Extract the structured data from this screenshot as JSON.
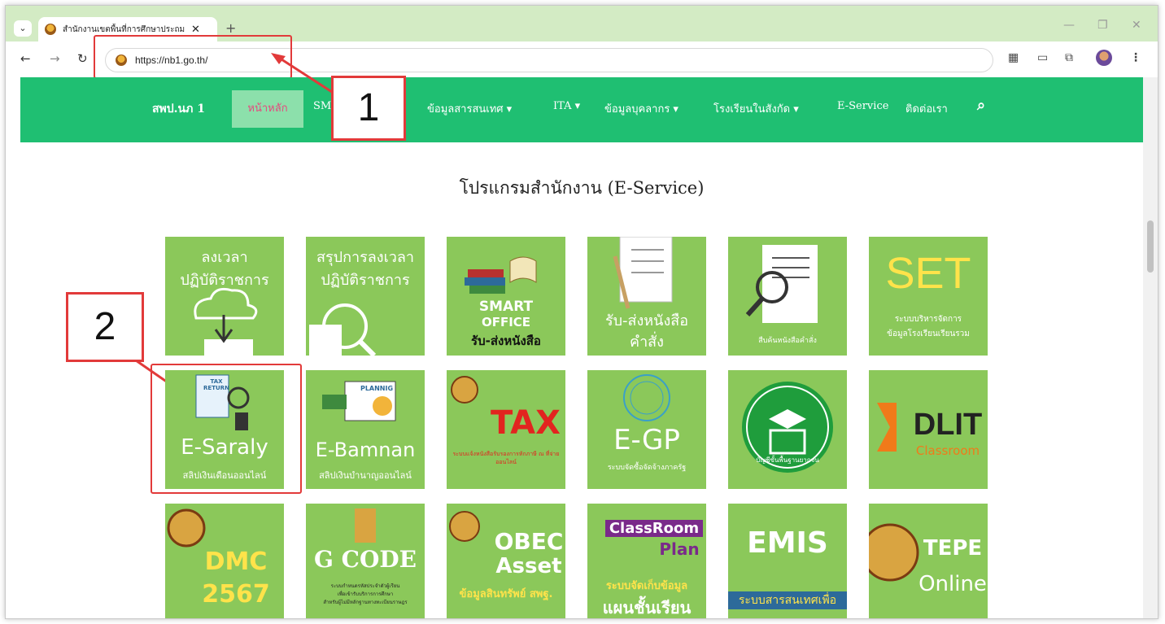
{
  "browser": {
    "tab_title": "สำนักงานเขตพื้นที่การศึกษาประถมศึ",
    "tab_close": "✕",
    "new_tab": "+",
    "url": "https://nb1.go.th/"
  },
  "site_nav": {
    "brand": "สพป.นภ 1",
    "items": [
      "หน้าหลัก",
      "SM",
      "ข้อมูลสารสนเทศ ▾",
      "ITA ▾",
      "ข้อมูลบุคลากร ▾",
      "โรงเรียนในสังกัด ▾",
      "E-Service",
      "ติดต่อเรา"
    ]
  },
  "markers": [
    "1",
    "2"
  ],
  "section_title": "โปรแกรมสำนักงาน (E-Service)",
  "tiles": [
    {
      "lines": [
        "ลงเวลา",
        "ปฏิบัติราชการ"
      ]
    },
    {
      "lines": [
        "สรุปการลงเวลา",
        "ปฏิบัติราชการ"
      ]
    },
    {
      "lines": [
        "SMART",
        "OFFICE",
        "รับ-ส่งหนังสือ"
      ]
    },
    {
      "lines": [
        "รับ-ส่งหนังสือ",
        "คำสั่ง"
      ]
    },
    {
      "lines": [
        "สืบค้นหนังสือคำสั่ง"
      ]
    },
    {
      "lines": [
        "SET",
        "ระบบบริหารจัดการ",
        "ข้อมูลโรงเรียนเรียนรวม"
      ]
    },
    {
      "lines": [
        "TAX",
        "RETURN",
        "E-Saraly",
        "สลิปเงินเดือนออนไลน์"
      ]
    },
    {
      "lines": [
        "PLANNIG",
        "E-Bamnan",
        "สลิปเงินบำนาญออนไลน์"
      ]
    },
    {
      "lines": [
        "TAX",
        "ระบบแจ้งหนังสือรับรองการหักภาษี ณ ที่จ่าย",
        "ออนไลน์"
      ]
    },
    {
      "lines": [
        "E-GP",
        "ระบบจัดซื้อจัดจ้างภาครัฐ"
      ]
    },
    {
      "lines": [
        "บัญชีขั้นพื้นฐานยากจน"
      ]
    },
    {
      "lines": [
        "DLIT",
        "Classroom"
      ]
    },
    {
      "lines": [
        "DMC",
        "2567"
      ]
    },
    {
      "lines": [
        "G CODE",
        "ระบบกำหนดรหัสประจำตัวผู้เรียน",
        "เพื่อเข้ารับบริการการศึกษา",
        "สำหรับผู้ไม่มีหลักฐานทางทะเบียนราษฎร"
      ]
    },
    {
      "lines": [
        "OBEC",
        "Asset",
        "ข้อมูลสินทรัพย์ สพฐ."
      ]
    },
    {
      "lines": [
        "ClassRoom",
        "Plan",
        "ระบบจัดเก็บข้อมูล",
        "แผนชั้นเรียน"
      ]
    },
    {
      "lines": [
        "EMIS",
        "ระบบสารสนเทศเพื่อ"
      ]
    },
    {
      "lines": [
        "TEPE",
        "Online"
      ]
    }
  ],
  "colors": {
    "nav_green": "#1fbf72",
    "tile_green": "#8bc85a",
    "annotation_red": "#e23a3a"
  }
}
